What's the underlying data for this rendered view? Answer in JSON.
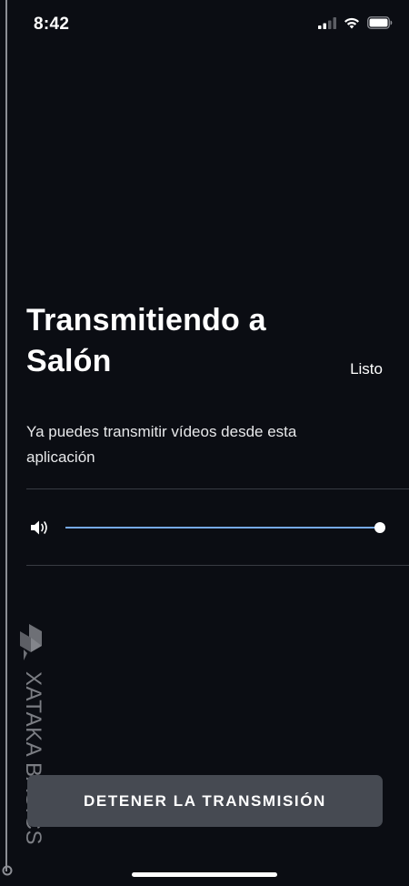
{
  "status_bar": {
    "time": "8:42",
    "icons": [
      "cellular-signal-icon",
      "wifi-icon",
      "battery-icon"
    ]
  },
  "cast": {
    "title": "Transmitiendo a Salón",
    "done_label": "Listo",
    "description": "Ya puedes transmitir vídeos desde esta aplicación",
    "volume": {
      "icon": "speaker-icon",
      "level": 1.0
    },
    "stop_button_label": "DETENER LA TRANSMISIÓN"
  },
  "watermark": {
    "text": "XATAKA BASICS",
    "logo": "xataka-logo-icon"
  },
  "colors": {
    "background": "#0b0d13",
    "slider_accent": "#76a9e8",
    "button_background": "#464a52"
  }
}
